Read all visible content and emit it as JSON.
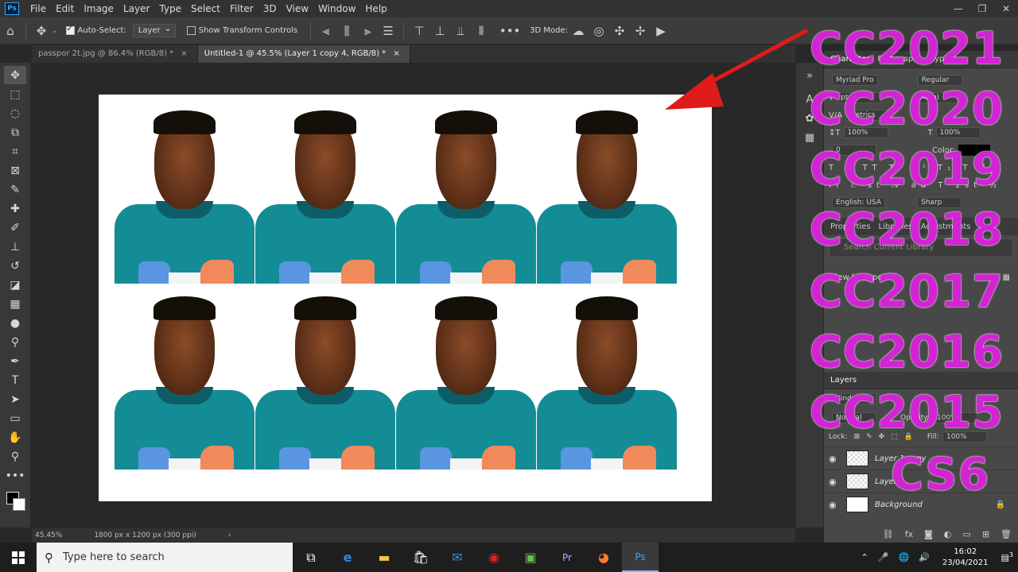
{
  "app": {
    "logo": "Ps",
    "menu": [
      "File",
      "Edit",
      "Image",
      "Layer",
      "Type",
      "Select",
      "Filter",
      "3D",
      "View",
      "Window",
      "Help"
    ],
    "window_controls": [
      "—",
      "❐",
      "✕"
    ]
  },
  "options_bar": {
    "auto_select_label": "Auto-Select:",
    "auto_select_checked": true,
    "auto_select_target": "Layer",
    "show_transform_label": "Show Transform Controls",
    "more_label": "•••",
    "mode_3d_label": "3D Mode:"
  },
  "tabs": [
    {
      "label": "passpor 2t.jpg @ 86.4% (RGB/8) *",
      "close": "×",
      "active": false
    },
    {
      "label": "Untitled-1 @ 45.5% (Layer 1 copy 4, RGB/8) *",
      "close": "×",
      "active": true
    }
  ],
  "status_bar": {
    "zoom": "45.45%",
    "doc_info": "1800 px x 1200 px (300 ppi)",
    "chevron": "›"
  },
  "right_panel": {
    "char_tabs": [
      "Character",
      "Paragraph",
      "Glyphs"
    ],
    "font_family": "Myriad Pro",
    "font_style": "Regular",
    "font_size": "pt",
    "leading": "(Auto)",
    "kerning": "Metrics",
    "vertical_scale": "100%",
    "horizontal_scale": "100%",
    "tracking": "0",
    "color_label": "Color:",
    "language": "English: USA",
    "antialias": "Sharp",
    "properties_tabs": [
      "Properties",
      "Libraries",
      "Adjustments"
    ],
    "library_search_placeholder": "Search Current Library",
    "view_by_label": "View by Type",
    "layers_title": "Layers",
    "blend_mode": "Normal",
    "opacity_label": "Opacity:",
    "opacity_value": "100%",
    "kind_label": "Kind",
    "lock_label": "Lock:",
    "fill_label": "Fill:",
    "fill_value": "100%",
    "layers": [
      {
        "name": "Layer 1 copy",
        "type": "transparent",
        "visible": true
      },
      {
        "name": "Layer 1",
        "type": "transparent",
        "visible": true
      },
      {
        "name": "Background",
        "type": "white",
        "visible": true,
        "locked": true
      }
    ]
  },
  "overlay": {
    "versions": [
      "CC2021",
      "CC2020",
      "CC2019",
      "CC2018",
      "CC2017",
      "CC2016",
      "CC2015",
      "CS6"
    ],
    "color": "#d224d4",
    "arrow_color": "#e01b1b"
  },
  "canvas": {
    "photo_count": 8,
    "shirt_color": "#138c96"
  },
  "taskbar": {
    "search_placeholder": "Type here to search",
    "time": "16:02",
    "date": "23/04/2021",
    "notification_count": "3"
  }
}
